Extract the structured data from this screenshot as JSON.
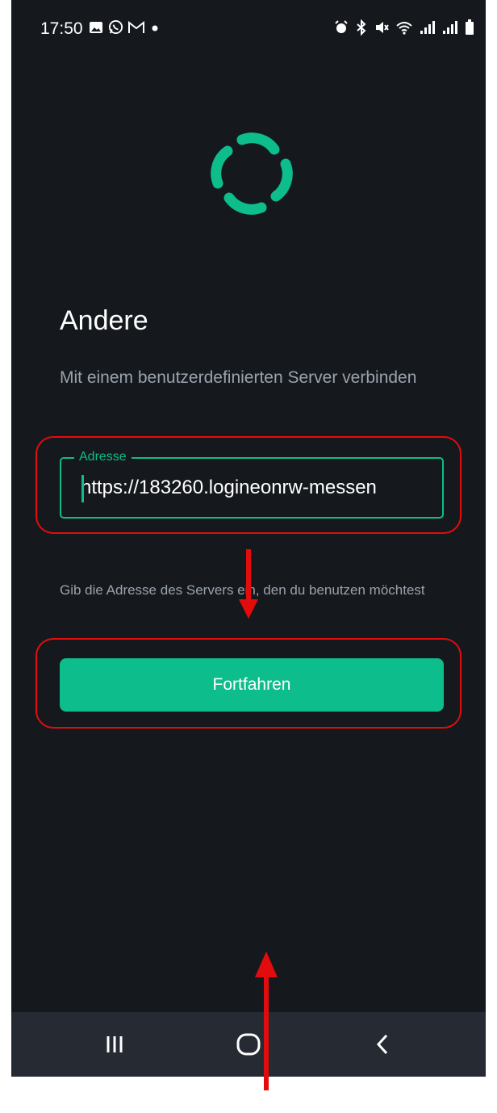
{
  "status_bar": {
    "time": "17:50",
    "left_icons": [
      "gallery-icon",
      "whatsapp-icon",
      "gmail-icon",
      "notification-dot"
    ],
    "right_icons": [
      "alarm-icon",
      "bluetooth-icon",
      "mute-icon",
      "wifi-icon",
      "signal-icon",
      "signal-icon",
      "battery-icon"
    ]
  },
  "logo": {
    "icon": "element-logo-icon",
    "color": "#0dbd8b"
  },
  "heading": {
    "title": "Andere",
    "subtitle": "Mit einem benutzerdefinierten Server verbinden"
  },
  "address_field": {
    "label": "Adresse",
    "value": "https://183260.logineonrw-messen"
  },
  "hint": "Gib die Adresse des Servers ein, den du benutzen möchtest",
  "continue_button": {
    "label": "Fortfahren"
  },
  "navigation": {
    "items": [
      "recent-apps-icon",
      "home-icon",
      "back-icon"
    ]
  },
  "colors": {
    "background": "#15191e",
    "accent": "#0dbd8b",
    "annotation": "#e30c0c"
  }
}
